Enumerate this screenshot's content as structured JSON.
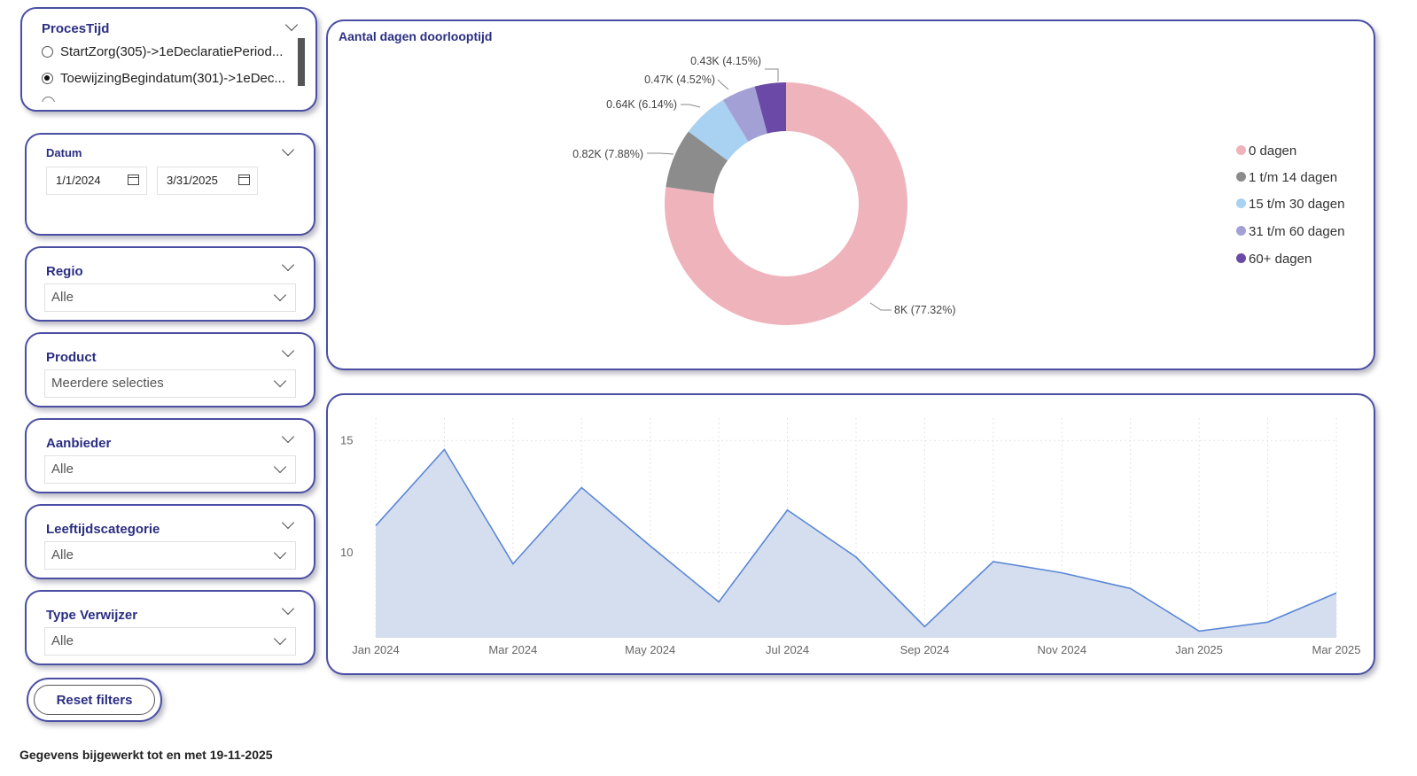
{
  "slicers": {
    "procestijd": {
      "title": "ProcesTijd",
      "options": [
        {
          "label": "StartZorg(305)->1eDeclaratiePeriod...",
          "selected": false
        },
        {
          "label": "ToewijzingBegindatum(301)->1eDec...",
          "selected": true
        }
      ]
    },
    "datum": {
      "title": "Datum",
      "start": "1/1/2024",
      "end": "3/31/2025"
    },
    "regio": {
      "title": "Regio",
      "value": "Alle"
    },
    "product": {
      "title": "Product",
      "value": "Meerdere selecties"
    },
    "aanbieder": {
      "title": "Aanbieder",
      "value": "Alle"
    },
    "leeftijd": {
      "title": "Leeftijdscategorie",
      "value": "Alle"
    },
    "verwijzer": {
      "title": "Type Verwijzer",
      "value": "Alle"
    }
  },
  "reset_label": "Reset filters",
  "footer": "Gegevens bijgewerkt tot en met 19-11-2025",
  "donut": {
    "title": "Aantal dagen doorlooptijd",
    "legend": [
      {
        "label": "0 dagen",
        "color": "#efb3bb"
      },
      {
        "label": "1 t/m 14 dagen",
        "color": "#8c8c8c"
      },
      {
        "label": "15 t/m 30 dagen",
        "color": "#a9d1f1"
      },
      {
        "label": "31 t/m 60 dagen",
        "color": "#a3a0d5"
      },
      {
        "label": "60+ dagen",
        "color": "#6a4aa6"
      }
    ],
    "data_labels": [
      "8K (77.32%)",
      "0.82K (7.88%)",
      "0.64K (6.14%)",
      "0.47K (4.52%)",
      "0.43K (4.15%)"
    ]
  },
  "chart_data": [
    {
      "type": "pie",
      "title": "Aantal dagen doorlooptijd",
      "categories": [
        "0 dagen",
        "1 t/m 14 dagen",
        "15 t/m 30 dagen",
        "31 t/m 60 dagen",
        "60+ dagen"
      ],
      "values": [
        8000,
        820,
        640,
        470,
        430
      ],
      "percentages": [
        77.32,
        7.88,
        6.14,
        4.52,
        4.15
      ]
    },
    {
      "type": "area",
      "x": [
        "Jan 2024",
        "Feb 2024",
        "Mar 2024",
        "Apr 2024",
        "May 2024",
        "Jun 2024",
        "Jul 2024",
        "Aug 2024",
        "Sep 2024",
        "Oct 2024",
        "Nov 2024",
        "Dec 2024",
        "Jan 2025",
        "Feb 2025",
        "Mar 2025"
      ],
      "x_tick_labels": [
        "Jan 2024",
        "Mar 2024",
        "May 2024",
        "Jul 2024",
        "Sep 2024",
        "Nov 2024",
        "Jan 2025",
        "Mar 2025"
      ],
      "y_tick_labels": [
        "15",
        "10"
      ],
      "ylim": [
        6.2,
        16
      ],
      "values": [
        11.2,
        14.6,
        9.5,
        12.9,
        10.3,
        7.8,
        11.9,
        9.8,
        6.7,
        9.6,
        9.1,
        8.4,
        6.5,
        6.9,
        8.2
      ],
      "color": "#5b87d6",
      "fill": "#d4deef",
      "grid": true
    }
  ]
}
